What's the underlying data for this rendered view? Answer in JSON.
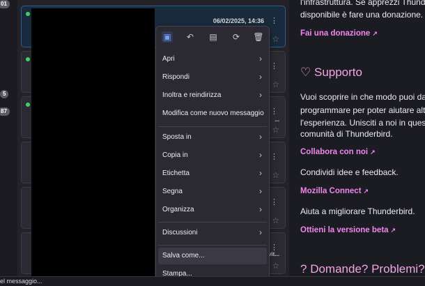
{
  "sidebar": {
    "counts": [
      "01",
      "5",
      "87"
    ]
  },
  "message_list": {
    "selected_date": "06/02/2025, 14:36",
    "row_snippets": [
      "",
      "...",
      "",
      "",
      "vit..."
    ]
  },
  "context_menu": {
    "quick_icons": [
      "archive-icon",
      "reply-icon",
      "save-box-icon",
      "refresh-icon",
      "trash-icon"
    ],
    "items": [
      {
        "label": "Apri",
        "submenu": true
      },
      {
        "label": "Rispondi",
        "submenu": true
      },
      {
        "label": "Inoltra e reindirizza",
        "submenu": true
      },
      {
        "label": "Modifica come nuovo messaggio",
        "submenu": false
      },
      {
        "label": "Sposta in",
        "submenu": true
      },
      {
        "label": "Copia in",
        "submenu": true
      },
      {
        "label": "Etichetta",
        "submenu": true
      },
      {
        "label": "Segna",
        "submenu": true
      },
      {
        "label": "Organizza",
        "submenu": true
      },
      {
        "label": "Discussioni",
        "submenu": true
      },
      {
        "label": "Salva come...",
        "submenu": false
      },
      {
        "label": "Stampa...",
        "submenu": false
      }
    ]
  },
  "info": {
    "line1": "l'infrastruttura. Se apprezzi Thunde",
    "line2": "disponibile è fare una donazione.",
    "donate_link": "Fai una donazione",
    "support_heading": "Supporto",
    "support_p1": "Vuoi scoprire in che modo puoi darc",
    "support_p2": "programmare per poter aiutare altri",
    "support_p3": "l'esperienza. Unisciti a noi in questo",
    "support_p4": "comunità di Thunderbird.",
    "collab_link": "Collabora con noi",
    "collab_text": "Condividi idee e feedback.",
    "mozconnect_link": "Mozilla Connect",
    "mozconnect_text": "Aiuta a migliorare Thunderbird.",
    "beta_link": "Ottieni la versione beta",
    "questions_heading": "Domande? Problemi?"
  },
  "status": {
    "text": "el messaggio..."
  }
}
